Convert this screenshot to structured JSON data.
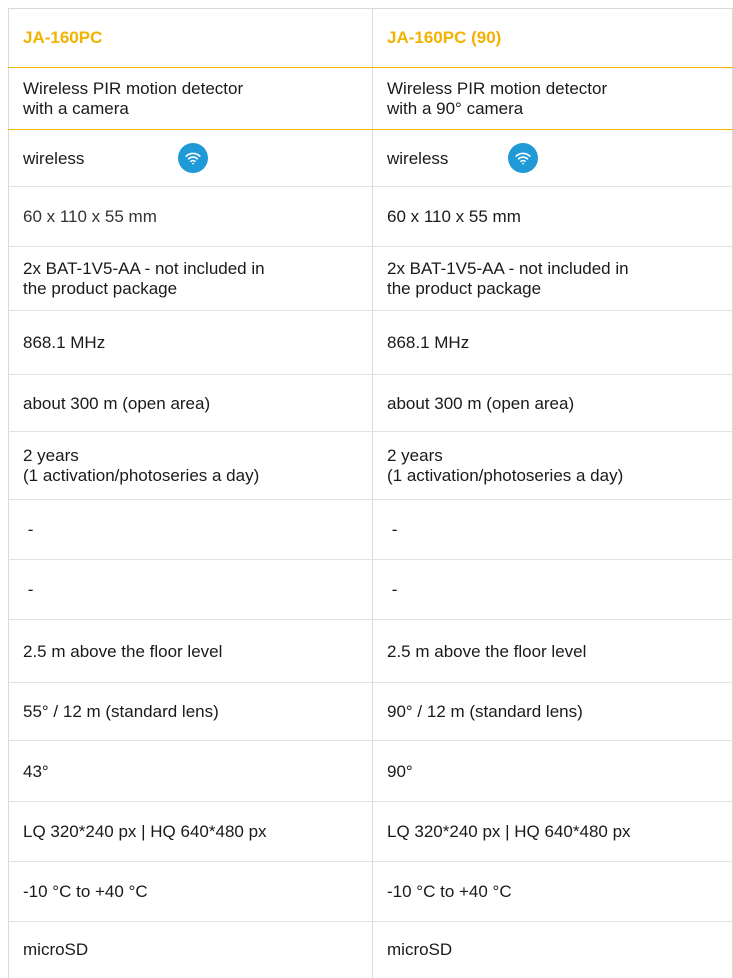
{
  "colors": {
    "accent": "#f2b200",
    "wifi_badge": "#1f9ad6"
  },
  "columns": [
    {
      "header": "JA-160PC",
      "description": [
        "Wireless PIR motion detector",
        "with a camera"
      ],
      "type": "wireless",
      "type_icon": "wifi-icon",
      "dimensions": "60 x 110 x 55 mm",
      "battery": [
        "2x BAT-1V5-AA - not included in",
        "the product package"
      ],
      "frequency": "868.1 MHz",
      "range": "about 300 m (open area)",
      "battery_life": [
        "2 years",
        "(1 activation/photoseries a day)"
      ],
      "blank_1": " -",
      "blank_2": " -",
      "install_height": "2.5 m above the floor level",
      "detection": "55° / 12 m (standard lens)",
      "camera_angle": "43°",
      "resolution": "LQ 320*240 px | HQ 640*480 px",
      "temperature": "-10 °C to +40 °C",
      "storage": "microSD"
    },
    {
      "header": "JA-160PC (90)",
      "description": [
        "Wireless PIR motion detector",
        "with a 90° camera"
      ],
      "type": "wireless",
      "type_icon": "wifi-icon",
      "dimensions": "60 x 110 x 55 mm",
      "battery": [
        "2x BAT-1V5-AA - not included in",
        "the product package"
      ],
      "frequency": "868.1 MHz",
      "range": "about 300 m (open area)",
      "battery_life": [
        "2 years",
        "(1 activation/photoseries a day)"
      ],
      "blank_1": " -",
      "blank_2": " -",
      "install_height": "2.5 m above the floor level",
      "detection": "90° / 12 m (standard lens)",
      "camera_angle": "90°",
      "resolution": "LQ 320*240 px | HQ 640*480 px",
      "temperature": "-10 °C to +40 °C",
      "storage": "microSD"
    }
  ]
}
